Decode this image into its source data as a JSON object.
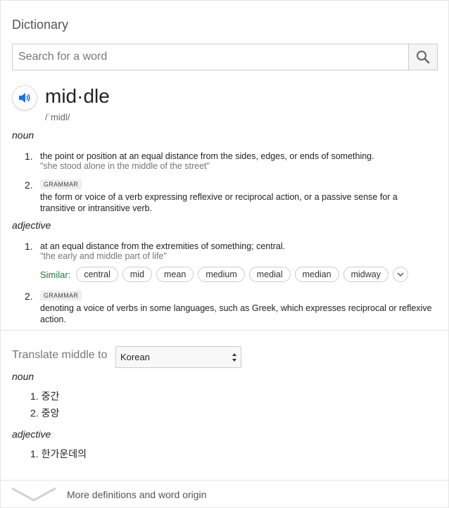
{
  "dictionary": {
    "title": "Dictionary",
    "search": {
      "placeholder": "Search for a word",
      "value": ""
    },
    "icons": {
      "search": "search-icon",
      "speaker": "speaker-icon"
    },
    "accent_color": "#1a73e8",
    "similar_color": "#188038",
    "word": "mid·dle",
    "phonetic": "/ˈmidl/",
    "senses": [
      {
        "pos": "noun",
        "definitions": [
          {
            "number": "1.",
            "text": "the point or position at an equal distance from the sides, edges, or ends of something.",
            "example": "\"she stood alone in the middle of the street\""
          },
          {
            "number": "2.",
            "tag": "GRAMMAR",
            "text": "the form or voice of a verb expressing reflexive or reciprocal action, or a passive sense for a transitive or intransitive verb."
          }
        ]
      },
      {
        "pos": "adjective",
        "definitions": [
          {
            "number": "1.",
            "text": "at an equal distance from the extremities of something; central.",
            "example": "\"the early and middle part of life\"",
            "similar_label": "Similar:",
            "similar": [
              "central",
              "mid",
              "mean",
              "medium",
              "medial",
              "median",
              "midway"
            ]
          },
          {
            "number": "2.",
            "tag": "GRAMMAR",
            "text": "denoting a voice of verbs in some languages, such as Greek, which expresses reciprocal or reflexive action."
          }
        ]
      }
    ]
  },
  "translate": {
    "label": "Translate middle to",
    "language": "Korean",
    "groups": [
      {
        "pos": "noun",
        "items": [
          "1. 중간",
          "2. 중앙"
        ]
      },
      {
        "pos": "adjective",
        "items": [
          "1. 한가운데의"
        ]
      }
    ]
  },
  "footer": {
    "more_label": "More definitions and word origin"
  }
}
